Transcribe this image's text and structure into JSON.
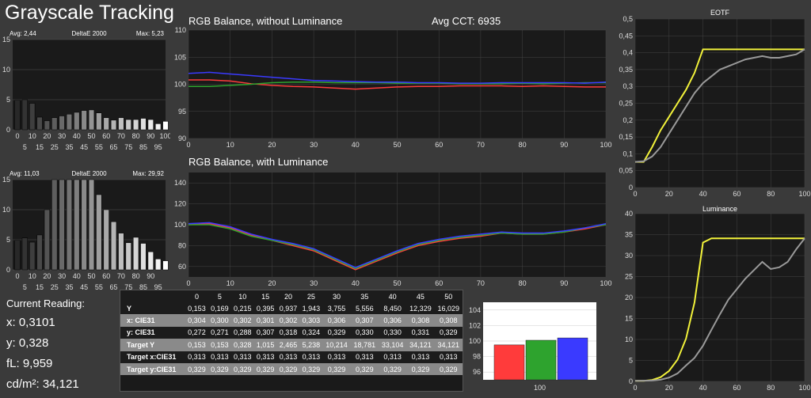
{
  "title": "Grayscale Tracking",
  "delta_e_top": {
    "avg": "Avg: 2,44",
    "label": "DeltaE 2000",
    "max": "Max: 5,23"
  },
  "delta_e_bottom": {
    "avg": "Avg: 11,03",
    "label": "DeltaE 2000",
    "max": "Max: 29,92"
  },
  "rgb_no_lum": {
    "title": "RGB Balance, without Luminance",
    "cct": "Avg CCT: 6935"
  },
  "rgb_lum": {
    "title": "RGB Balance, with Luminance"
  },
  "eotf": {
    "title": "EOTF"
  },
  "luminance": {
    "title": "Luminance"
  },
  "current_reading": {
    "label": "Current Reading:",
    "x": "x: 0,3101",
    "y": "y: 0,328",
    "fL": "fL: 9,959",
    "cdm2": "cd/m²: 34,121"
  },
  "table": {
    "headers": [
      "",
      "0",
      "5",
      "10",
      "15",
      "20",
      "25",
      "30",
      "35",
      "40",
      "45",
      "50"
    ],
    "rows": [
      {
        "label": "Y",
        "values": [
          "0,153",
          "0,169",
          "0,215",
          "0,395",
          "0,937",
          "1,943",
          "3,755",
          "5,556",
          "8,450",
          "12,329",
          "16,029"
        ]
      },
      {
        "label": "x: CIE31",
        "values": [
          "0,304",
          "0,300",
          "0,302",
          "0,301",
          "0,302",
          "0,303",
          "0,306",
          "0,307",
          "0,306",
          "0,308",
          "0,308"
        ]
      },
      {
        "label": "y: CIE31",
        "values": [
          "0,272",
          "0,271",
          "0,288",
          "0,307",
          "0,318",
          "0,324",
          "0,329",
          "0,330",
          "0,330",
          "0,331",
          "0,329"
        ]
      },
      {
        "label": "Target Y",
        "values": [
          "0,153",
          "0,153",
          "0,328",
          "1,015",
          "2,465",
          "5,238",
          "10,214",
          "18,781",
          "33,104",
          "34,121",
          "34,121"
        ]
      },
      {
        "label": "Target x:CIE31",
        "values": [
          "0,313",
          "0,313",
          "0,313",
          "0,313",
          "0,313",
          "0,313",
          "0,313",
          "0,313",
          "0,313",
          "0,313",
          "0,313"
        ]
      },
      {
        "label": "Target y:CIE31",
        "values": [
          "0,329",
          "0,329",
          "0,329",
          "0,329",
          "0,329",
          "0,329",
          "0,329",
          "0,329",
          "0,329",
          "0,329",
          "0,329"
        ]
      }
    ]
  },
  "colors": {
    "red": "#ff3b3b",
    "green": "#2ea32e",
    "blue": "#3a3aff",
    "yellow": "#f2f23a",
    "gray": "#9a9a9a",
    "magenta": "#a020d0"
  },
  "chart_data": [
    {
      "type": "bar",
      "title": "DeltaE 2000",
      "categories": [
        "0",
        "5",
        "10",
        "15",
        "20",
        "25",
        "30",
        "35",
        "40",
        "45",
        "50",
        "55",
        "60",
        "65",
        "70",
        "75",
        "80",
        "85",
        "90",
        "95",
        "100"
      ],
      "values": [
        4.9,
        5.0,
        4.4,
        2.1,
        1.5,
        2.0,
        2.3,
        2.6,
        2.9,
        3.2,
        3.3,
        2.8,
        2.0,
        1.6,
        2.0,
        1.7,
        1.7,
        1.9,
        1.7,
        1.0,
        1.4
      ],
      "ylim": [
        0,
        15
      ],
      "yticks": [
        0,
        5,
        10,
        15
      ],
      "xticks_top": [
        "0",
        "10",
        "20",
        "30",
        "40",
        "50",
        "60",
        "70",
        "80",
        "90",
        "100"
      ],
      "xticks_bottom": [
        "5",
        "15",
        "25",
        "35",
        "45",
        "55",
        "65",
        "75",
        "85",
        "95"
      ]
    },
    {
      "type": "bar",
      "title": "DeltaE 2000",
      "categories": [
        "0",
        "5",
        "10",
        "15",
        "20",
        "25",
        "30",
        "35",
        "40",
        "45",
        "50",
        "55",
        "60",
        "65",
        "70",
        "75",
        "80",
        "85",
        "90",
        "95",
        "100"
      ],
      "values": [
        4.9,
        5.3,
        4.6,
        5.8,
        10.0,
        15,
        15,
        15,
        15,
        15,
        15,
        12.5,
        10.0,
        8.0,
        6.1,
        4.5,
        5.4,
        4.4,
        3.0,
        1.8,
        1.5
      ],
      "ylim": [
        0,
        15
      ],
      "yticks": [
        0,
        5,
        10,
        15
      ],
      "xticks_top": [
        "0",
        "10",
        "20",
        "30",
        "40",
        "50",
        "60",
        "70",
        "80",
        "90"
      ],
      "xticks_bottom": [
        "5",
        "15",
        "25",
        "35",
        "45",
        "55",
        "65",
        "75",
        "85",
        "95"
      ]
    },
    {
      "type": "line",
      "title": "RGB Balance, without Luminance",
      "x": [
        0,
        5,
        10,
        15,
        20,
        25,
        30,
        35,
        40,
        45,
        50,
        55,
        60,
        65,
        70,
        75,
        80,
        85,
        90,
        95,
        100
      ],
      "series": [
        {
          "color": "red",
          "values": [
            100.8,
            100.8,
            100.6,
            100.1,
            99.8,
            99.6,
            99.5,
            99.3,
            99.1,
            99.3,
            99.5,
            99.6,
            99.6,
            99.7,
            99.7,
            99.7,
            99.6,
            99.7,
            99.6,
            99.5,
            99.5
          ]
        },
        {
          "color": "green",
          "values": [
            99.6,
            99.6,
            99.8,
            100.0,
            100.3,
            100.4,
            100.4,
            100.3,
            100.3,
            100.3,
            100.2,
            100.2,
            100.2,
            100.1,
            100.1,
            100.1,
            100.2,
            100.1,
            100.2,
            100.3,
            100.3
          ]
        },
        {
          "color": "blue",
          "values": [
            102.0,
            102.2,
            101.9,
            101.6,
            101.3,
            101.0,
            100.7,
            100.6,
            100.5,
            100.4,
            100.4,
            100.3,
            100.3,
            100.2,
            100.2,
            100.3,
            100.3,
            100.3,
            100.3,
            100.2,
            100.4
          ]
        }
      ],
      "xlim": [
        0,
        100
      ],
      "ylim": [
        90,
        110
      ],
      "yticks": [
        90,
        95,
        100,
        105,
        110
      ],
      "xticks": [
        0,
        10,
        20,
        30,
        40,
        50,
        60,
        70,
        80,
        90,
        100
      ]
    },
    {
      "type": "line",
      "title": "RGB Balance, with Luminance",
      "x": [
        0,
        5,
        10,
        15,
        20,
        25,
        30,
        35,
        40,
        45,
        50,
        55,
        60,
        65,
        70,
        75,
        80,
        85,
        90,
        95,
        100
      ],
      "series": [
        {
          "color": "red",
          "values": [
            100,
            101,
            97,
            90,
            85,
            80,
            75,
            66,
            57,
            65,
            73,
            80,
            84,
            87,
            89,
            92,
            91,
            91,
            93,
            96,
            100
          ]
        },
        {
          "color": "green",
          "values": [
            100,
            100,
            96,
            89,
            85,
            81,
            76,
            67,
            58,
            66,
            74,
            81,
            85,
            88,
            90,
            92,
            91,
            91,
            93,
            97,
            100
          ]
        },
        {
          "color": "blue",
          "values": [
            101,
            102,
            98,
            91,
            86,
            82,
            77,
            68,
            59,
            67,
            75,
            82,
            86,
            89,
            91,
            93,
            92,
            92,
            94,
            97,
            101
          ]
        }
      ],
      "xlim": [
        0,
        100
      ],
      "ylim": [
        50,
        150
      ],
      "yticks": [
        60,
        80,
        100,
        120,
        140
      ],
      "xticks": [
        0,
        10,
        20,
        30,
        40,
        50,
        60,
        70,
        80,
        90,
        100
      ]
    },
    {
      "type": "line",
      "title": "EOTF",
      "x": [
        0,
        5,
        10,
        15,
        20,
        25,
        30,
        35,
        40,
        45,
        50,
        55,
        60,
        65,
        70,
        75,
        80,
        85,
        90,
        95,
        100
      ],
      "series": [
        {
          "color": "yellow",
          "values": [
            0.076,
            0.076,
            0.12,
            0.17,
            0.21,
            0.25,
            0.29,
            0.34,
            0.41,
            0.41,
            0.41,
            0.41,
            0.41,
            0.41,
            0.41,
            0.41,
            0.41,
            0.41,
            0.41,
            0.41,
            0.41
          ]
        },
        {
          "color": "gray",
          "values": [
            0.076,
            0.078,
            0.092,
            0.12,
            0.16,
            0.2,
            0.24,
            0.28,
            0.31,
            0.33,
            0.35,
            0.36,
            0.37,
            0.38,
            0.385,
            0.39,
            0.385,
            0.385,
            0.39,
            0.395,
            0.41
          ]
        }
      ],
      "xlim": [
        0,
        100
      ],
      "ylim": [
        0,
        0.5
      ],
      "yticks": [
        "0",
        "0,05",
        "0,1",
        "0,15",
        "0,2",
        "0,25",
        "0,3",
        "0,35",
        "0,4",
        "0,45",
        "0,5"
      ],
      "xticks": [
        0,
        20,
        40,
        60,
        80,
        100
      ]
    },
    {
      "type": "line",
      "title": "Luminance",
      "x": [
        0,
        5,
        10,
        15,
        20,
        25,
        30,
        35,
        40,
        45,
        50,
        55,
        60,
        65,
        70,
        75,
        80,
        85,
        90,
        95,
        100
      ],
      "series": [
        {
          "color": "yellow",
          "values": [
            0.15,
            0.15,
            0.33,
            1.0,
            2.5,
            5.2,
            10.2,
            18.8,
            33.1,
            34.1,
            34.1,
            34.1,
            34.1,
            34.1,
            34.1,
            34.1,
            34.1,
            34.1,
            34.1,
            34.1,
            34.1
          ]
        },
        {
          "color": "gray",
          "values": [
            0.15,
            0.17,
            0.21,
            0.4,
            0.9,
            1.9,
            3.8,
            5.6,
            8.5,
            12.3,
            16.0,
            19.5,
            22.0,
            24.5,
            26.5,
            28.5,
            26.8,
            27.2,
            28.5,
            31.5,
            34.1
          ]
        }
      ],
      "xlim": [
        0,
        100
      ],
      "ylim": [
        0,
        40
      ],
      "yticks": [
        0,
        5,
        10,
        15,
        20,
        25,
        30,
        35,
        40
      ],
      "xticks": [
        0,
        20,
        40,
        60,
        80,
        100
      ]
    },
    {
      "type": "bar",
      "categories": [
        "100"
      ],
      "series": [
        {
          "color": "red",
          "values": [
            99.5
          ]
        },
        {
          "color": "green",
          "values": [
            100.1
          ]
        },
        {
          "color": "blue",
          "values": [
            100.4
          ]
        }
      ],
      "ylim": [
        95,
        105
      ],
      "yticks": [
        96,
        98,
        100,
        102,
        104
      ]
    }
  ]
}
